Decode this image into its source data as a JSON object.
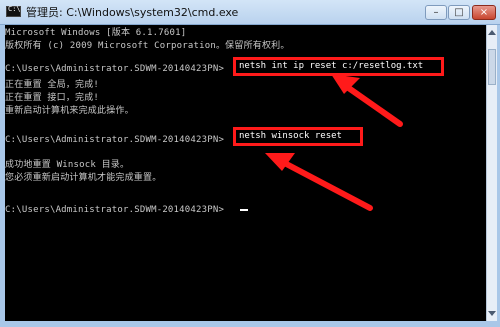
{
  "window": {
    "title": "管理员: C:\\Windows\\system32\\cmd.exe",
    "buttons": [
      "–",
      "□",
      "×"
    ]
  },
  "console": {
    "lines": [
      "Microsoft Windows [版本 6.1.7601]",
      "版权所有 (c) 2009 Microsoft Corporation。保留所有权利。",
      "C:\\Users\\Administrator.SDWM-20140423PN>",
      "正在重置 全局，完成!",
      "正在重置 接口，完成!",
      "重新启动计算机来完成此操作。",
      "C:\\Users\\Administrator.SDWM-20140423PN>",
      "成功地重置 Winsock 目录。",
      "您必须重新启动计算机才能完成重置。",
      "C:\\Users\\Administrator.SDWM-20140423PN>"
    ],
    "highlighted_commands": [
      "netsh int ip reset c:/resetlog.txt",
      "netsh winsock reset"
    ],
    "cursor": "_"
  },
  "colors": {
    "console_bg": "#000000",
    "console_text": "#c8c8c8",
    "annotation_red": "#ff1a1a"
  }
}
